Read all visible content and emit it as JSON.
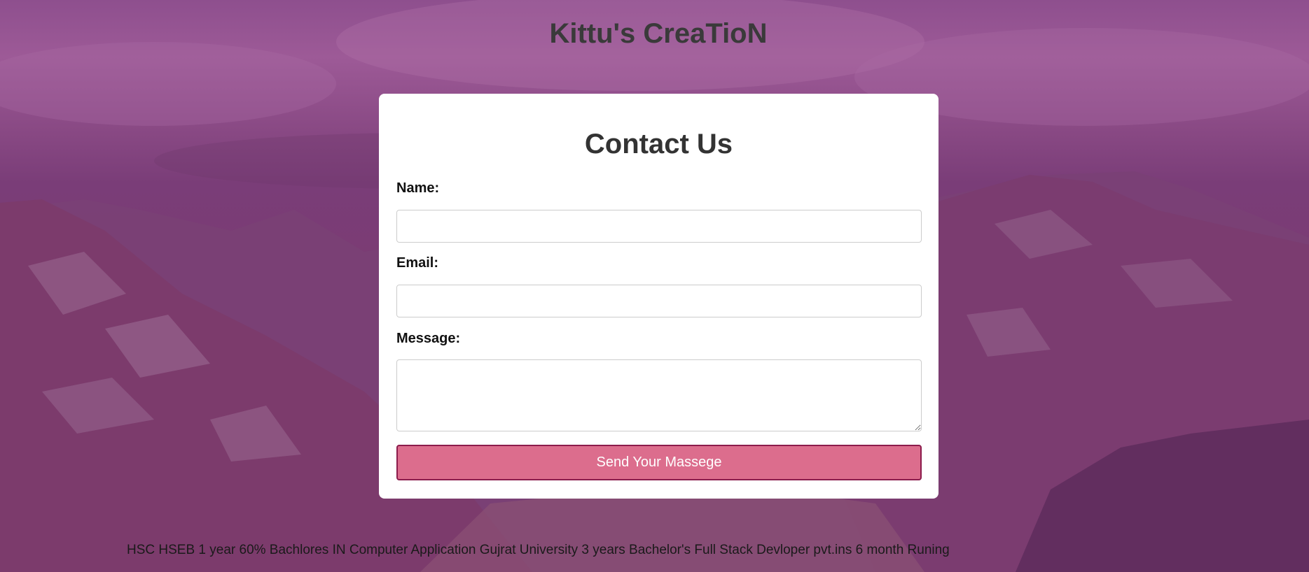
{
  "header": {
    "site_title": "Kittu's CreaTioN"
  },
  "contact_form": {
    "title": "Contact Us",
    "name_label": "Name:",
    "name_value": "",
    "email_label": "Email:",
    "email_value": "",
    "message_label": "Message:",
    "message_value": "",
    "submit_label": "Send Your Massege"
  },
  "footer": {
    "text": "HSC HSEB 1 year 60% Bachlores IN Computer Application Gujrat University 3 years Bachelor's Full Stack Devloper pvt.ins 6 month Runing"
  },
  "colors": {
    "background_tint": "#8a4a85",
    "card_background": "#ffffff",
    "button_fill": "#dc6d8d",
    "button_border": "#8c1c4c",
    "title_text": "#3a3a3a"
  }
}
